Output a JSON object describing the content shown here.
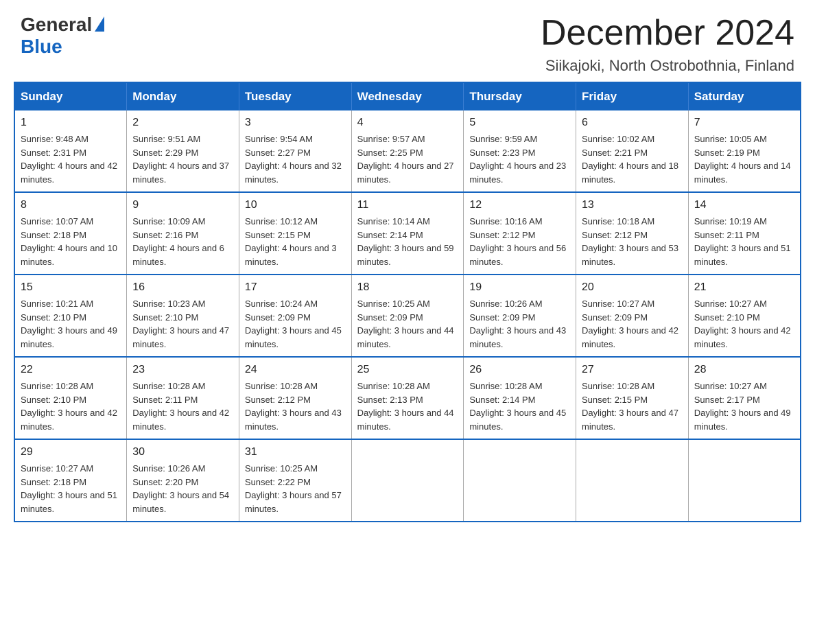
{
  "logo": {
    "general": "General",
    "blue": "Blue"
  },
  "title": "December 2024",
  "location": "Siikajoki, North Ostrobothnia, Finland",
  "days_of_week": [
    "Sunday",
    "Monday",
    "Tuesday",
    "Wednesday",
    "Thursday",
    "Friday",
    "Saturday"
  ],
  "weeks": [
    [
      {
        "day": "1",
        "sunrise": "9:48 AM",
        "sunset": "2:31 PM",
        "daylight": "4 hours and 42 minutes."
      },
      {
        "day": "2",
        "sunrise": "9:51 AM",
        "sunset": "2:29 PM",
        "daylight": "4 hours and 37 minutes."
      },
      {
        "day": "3",
        "sunrise": "9:54 AM",
        "sunset": "2:27 PM",
        "daylight": "4 hours and 32 minutes."
      },
      {
        "day": "4",
        "sunrise": "9:57 AM",
        "sunset": "2:25 PM",
        "daylight": "4 hours and 27 minutes."
      },
      {
        "day": "5",
        "sunrise": "9:59 AM",
        "sunset": "2:23 PM",
        "daylight": "4 hours and 23 minutes."
      },
      {
        "day": "6",
        "sunrise": "10:02 AM",
        "sunset": "2:21 PM",
        "daylight": "4 hours and 18 minutes."
      },
      {
        "day": "7",
        "sunrise": "10:05 AM",
        "sunset": "2:19 PM",
        "daylight": "4 hours and 14 minutes."
      }
    ],
    [
      {
        "day": "8",
        "sunrise": "10:07 AM",
        "sunset": "2:18 PM",
        "daylight": "4 hours and 10 minutes."
      },
      {
        "day": "9",
        "sunrise": "10:09 AM",
        "sunset": "2:16 PM",
        "daylight": "4 hours and 6 minutes."
      },
      {
        "day": "10",
        "sunrise": "10:12 AM",
        "sunset": "2:15 PM",
        "daylight": "4 hours and 3 minutes."
      },
      {
        "day": "11",
        "sunrise": "10:14 AM",
        "sunset": "2:14 PM",
        "daylight": "3 hours and 59 minutes."
      },
      {
        "day": "12",
        "sunrise": "10:16 AM",
        "sunset": "2:12 PM",
        "daylight": "3 hours and 56 minutes."
      },
      {
        "day": "13",
        "sunrise": "10:18 AM",
        "sunset": "2:12 PM",
        "daylight": "3 hours and 53 minutes."
      },
      {
        "day": "14",
        "sunrise": "10:19 AM",
        "sunset": "2:11 PM",
        "daylight": "3 hours and 51 minutes."
      }
    ],
    [
      {
        "day": "15",
        "sunrise": "10:21 AM",
        "sunset": "2:10 PM",
        "daylight": "3 hours and 49 minutes."
      },
      {
        "day": "16",
        "sunrise": "10:23 AM",
        "sunset": "2:10 PM",
        "daylight": "3 hours and 47 minutes."
      },
      {
        "day": "17",
        "sunrise": "10:24 AM",
        "sunset": "2:09 PM",
        "daylight": "3 hours and 45 minutes."
      },
      {
        "day": "18",
        "sunrise": "10:25 AM",
        "sunset": "2:09 PM",
        "daylight": "3 hours and 44 minutes."
      },
      {
        "day": "19",
        "sunrise": "10:26 AM",
        "sunset": "2:09 PM",
        "daylight": "3 hours and 43 minutes."
      },
      {
        "day": "20",
        "sunrise": "10:27 AM",
        "sunset": "2:09 PM",
        "daylight": "3 hours and 42 minutes."
      },
      {
        "day": "21",
        "sunrise": "10:27 AM",
        "sunset": "2:10 PM",
        "daylight": "3 hours and 42 minutes."
      }
    ],
    [
      {
        "day": "22",
        "sunrise": "10:28 AM",
        "sunset": "2:10 PM",
        "daylight": "3 hours and 42 minutes."
      },
      {
        "day": "23",
        "sunrise": "10:28 AM",
        "sunset": "2:11 PM",
        "daylight": "3 hours and 42 minutes."
      },
      {
        "day": "24",
        "sunrise": "10:28 AM",
        "sunset": "2:12 PM",
        "daylight": "3 hours and 43 minutes."
      },
      {
        "day": "25",
        "sunrise": "10:28 AM",
        "sunset": "2:13 PM",
        "daylight": "3 hours and 44 minutes."
      },
      {
        "day": "26",
        "sunrise": "10:28 AM",
        "sunset": "2:14 PM",
        "daylight": "3 hours and 45 minutes."
      },
      {
        "day": "27",
        "sunrise": "10:28 AM",
        "sunset": "2:15 PM",
        "daylight": "3 hours and 47 minutes."
      },
      {
        "day": "28",
        "sunrise": "10:27 AM",
        "sunset": "2:17 PM",
        "daylight": "3 hours and 49 minutes."
      }
    ],
    [
      {
        "day": "29",
        "sunrise": "10:27 AM",
        "sunset": "2:18 PM",
        "daylight": "3 hours and 51 minutes."
      },
      {
        "day": "30",
        "sunrise": "10:26 AM",
        "sunset": "2:20 PM",
        "daylight": "3 hours and 54 minutes."
      },
      {
        "day": "31",
        "sunrise": "10:25 AM",
        "sunset": "2:22 PM",
        "daylight": "3 hours and 57 minutes."
      },
      null,
      null,
      null,
      null
    ]
  ]
}
